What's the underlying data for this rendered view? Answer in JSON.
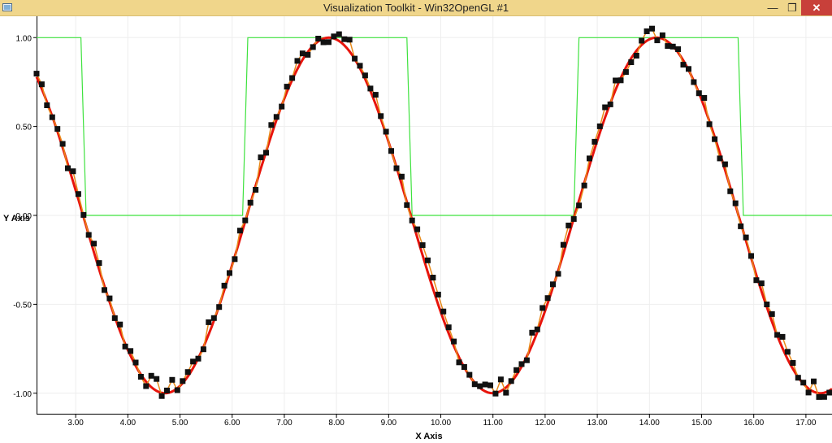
{
  "window": {
    "title": "Visualization Toolkit - Win32OpenGL #1",
    "buttons": {
      "minimize": "—",
      "maximize": "❐",
      "close": "✕"
    },
    "title_bar_color": "#f0d68b",
    "close_color": "#c8403a"
  },
  "chart_data": {
    "type": "line",
    "xlabel": "X Axis",
    "ylabel": "Y Axis",
    "xlim": [
      2.25,
      17.5
    ],
    "ylim": [
      -1.12,
      1.12
    ],
    "x_ticks": [
      "3.00",
      "4.00",
      "5.00",
      "6.00",
      "7.00",
      "8.00",
      "9.00",
      "10.00",
      "11.00",
      "12.00",
      "13.00",
      "14.00",
      "15.00",
      "16.00",
      "17.00"
    ],
    "y_ticks": [
      "1.00",
      "0.50",
      "0.00",
      "-0.50",
      "-1.00"
    ],
    "grid": true,
    "series": [
      {
        "kind": "sine",
        "color": "#e8140c",
        "x_range": [
          2.25,
          17.5
        ],
        "step": 0.05
      },
      {
        "kind": "square",
        "color": "#3ee23e",
        "x": [
          2.25,
          3.1,
          3.2,
          6.2,
          6.3,
          9.35,
          9.45,
          12.55,
          12.65,
          15.7,
          15.8,
          17.5
        ],
        "y": [
          1,
          1,
          0,
          0,
          1,
          1,
          0,
          0,
          1,
          1,
          0,
          0
        ]
      },
      {
        "kind": "noisy_sine",
        "color": "#e88a1a",
        "marker_color": "#111111",
        "x_range": [
          2.25,
          17.5
        ],
        "step": 0.1
      }
    ]
  }
}
